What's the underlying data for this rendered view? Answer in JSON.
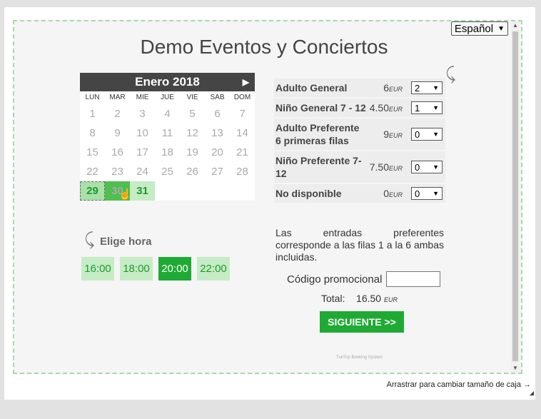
{
  "language": "Español",
  "title": "Demo Eventos y Conciertos",
  "calendar": {
    "month": "Enero 2018",
    "next": "▶",
    "weekdays": [
      "LUN",
      "MAR",
      "MIE",
      "JUE",
      "VIE",
      "SAB",
      "DOM"
    ],
    "weeks": [
      [
        "1",
        "2",
        "3",
        "4",
        "5",
        "6",
        "7"
      ],
      [
        "8",
        "9",
        "10",
        "11",
        "12",
        "13",
        "14"
      ],
      [
        "15",
        "16",
        "17",
        "18",
        "19",
        "20",
        "21"
      ],
      [
        "22",
        "23",
        "24",
        "25",
        "26",
        "27",
        "28"
      ],
      [
        "29",
        "30",
        "31",
        "",
        "",
        "",
        ""
      ]
    ]
  },
  "time_label": "Elige hora",
  "times": [
    "16:00",
    "18:00",
    "20:00",
    "22:00"
  ],
  "tickets": [
    {
      "name": "Adulto General",
      "price": "6",
      "currency": "EUR",
      "qty": "2"
    },
    {
      "name": "Niño General 7 - 12",
      "price": "4.50",
      "currency": "EUR",
      "qty": "1"
    },
    {
      "name": "Adulto Preferente 6 primeras filas",
      "price": "9",
      "currency": "EUR",
      "qty": "0"
    },
    {
      "name": "Niño Preferente 7-12",
      "price": "7.50",
      "currency": "EUR",
      "qty": "0"
    },
    {
      "name": "No disponible",
      "price": "0",
      "currency": "EUR",
      "qty": "0"
    }
  ],
  "note": "Las entradas preferentes corresponde a las filas 1 a la 6 ambas incluidas.",
  "promo_label": "Código promocional",
  "total_label": "Total:",
  "total_value": "16.50",
  "total_currency": "EUR",
  "button_label": "SIGUIENTE >>",
  "powered_by": "TuriTop Booking System",
  "resize_hint": "Arrastrar para cambiar tamaño de caja →",
  "colors": {
    "accent": "#1faa34",
    "available": "#c5ecc5",
    "header": "#454545"
  }
}
